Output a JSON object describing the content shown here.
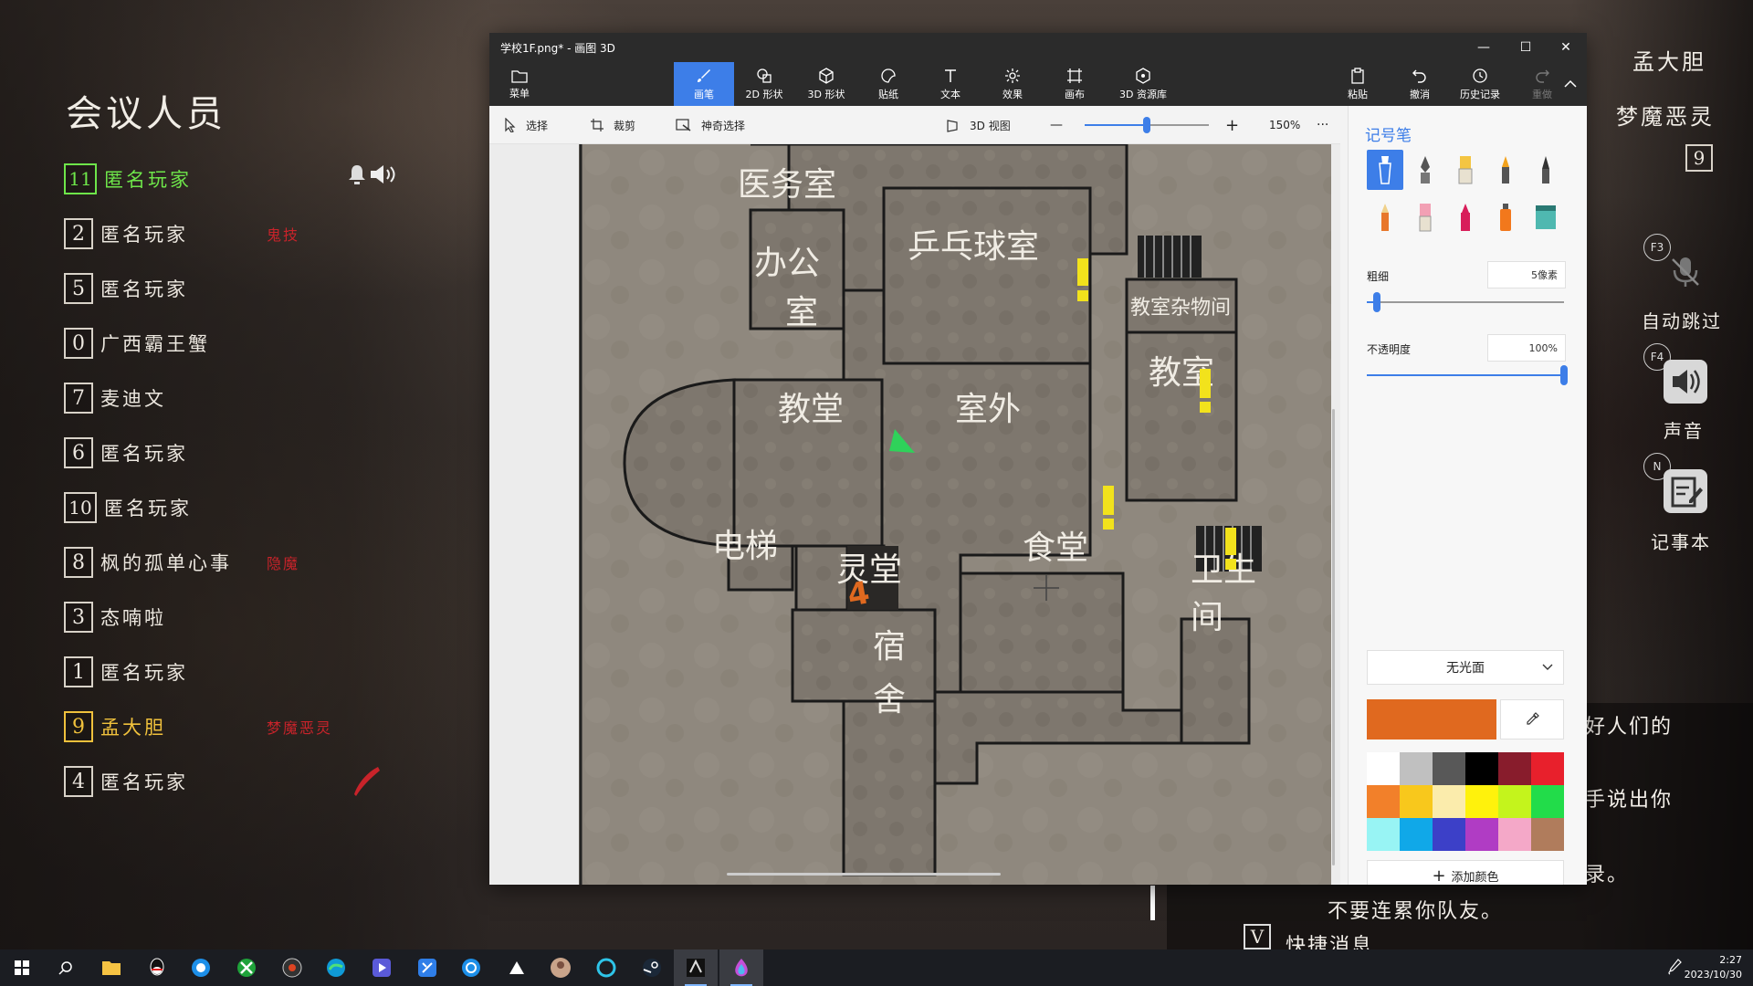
{
  "game": {
    "participants_title": "会议人员",
    "participants": [
      {
        "num": "11",
        "name": "匿名玩家",
        "tag": "",
        "state": "speaking"
      },
      {
        "num": "2",
        "name": "匿名玩家",
        "tag": "鬼技",
        "state": "normal"
      },
      {
        "num": "5",
        "name": "匿名玩家",
        "tag": "",
        "state": "normal"
      },
      {
        "num": "0",
        "name": "广西霸王蟹",
        "tag": "",
        "state": "normal"
      },
      {
        "num": "7",
        "name": "麦迪文",
        "tag": "",
        "state": "normal"
      },
      {
        "num": "6",
        "name": "匿名玩家",
        "tag": "",
        "state": "normal"
      },
      {
        "num": "10",
        "name": "匿名玩家",
        "tag": "",
        "state": "normal"
      },
      {
        "num": "8",
        "name": "枫的孤单心事",
        "tag": "隐魔",
        "state": "normal"
      },
      {
        "num": "3",
        "name": "态喃啦",
        "tag": "",
        "state": "normal"
      },
      {
        "num": "1",
        "name": "匿名玩家",
        "tag": "",
        "state": "normal"
      },
      {
        "num": "9",
        "name": "孟大胆",
        "tag": "梦魔恶灵",
        "state": "gold"
      },
      {
        "num": "4",
        "name": "匿名玩家",
        "tag": "",
        "state": "normal"
      }
    ],
    "hud": {
      "player_name": "孟大胆",
      "player_role": "梦魔恶灵",
      "player_number": "9",
      "auto_skip_key": "F3",
      "auto_skip_label": "自动跳过",
      "sound_key": "F4",
      "sound_label": "声音",
      "notebook_key": "N",
      "notebook_label": "记事本"
    },
    "chat": {
      "line1": "好人们的",
      "line2": "手说出你",
      "line3": "录。",
      "line4": "不要连累你队友。",
      "quick_key": "V",
      "quick_label": "快捷消息"
    }
  },
  "paint": {
    "window_title": "学校1F.png* - 画图 3D",
    "controls": {
      "minimize": "—",
      "maximize": "☐",
      "close": "✕"
    },
    "ribbon": [
      {
        "label": "菜单",
        "icon": "folder-icon",
        "state": "normal"
      },
      {
        "label": "画笔",
        "icon": "brush-icon",
        "state": "active"
      },
      {
        "label": "2D 形状",
        "icon": "shapes-2d-icon",
        "state": "normal"
      },
      {
        "label": "3D 形状",
        "icon": "shapes-3d-icon",
        "state": "normal"
      },
      {
        "label": "贴纸",
        "icon": "sticker-icon",
        "state": "normal"
      },
      {
        "label": "文本",
        "icon": "text-icon",
        "state": "normal"
      },
      {
        "label": "效果",
        "icon": "effects-icon",
        "state": "normal"
      },
      {
        "label": "画布",
        "icon": "canvas-icon",
        "state": "normal"
      },
      {
        "label": "3D 资源库",
        "icon": "library-3d-icon",
        "state": "normal"
      },
      {
        "label": "粘贴",
        "icon": "paste-icon",
        "state": "normal"
      },
      {
        "label": "撤消",
        "icon": "undo-icon",
        "state": "normal"
      },
      {
        "label": "历史记录",
        "icon": "history-icon",
        "state": "normal"
      },
      {
        "label": "重做",
        "icon": "redo-icon",
        "state": "disabled"
      }
    ],
    "cmd": {
      "select": "选择",
      "crop": "裁剪",
      "magic_select": "神奇选择",
      "view_3d": "3D 视图",
      "zoom_minus": "—",
      "zoom_plus": "+",
      "zoom_level": "150%",
      "zoom_fraction": 0.5,
      "more": "···"
    },
    "panel": {
      "title": "记号笔",
      "thickness_label": "粗细",
      "thickness_value": "5像素",
      "thickness_fraction": 0.05,
      "opacity_label": "不透明度",
      "opacity_value": "100%",
      "opacity_fraction": 1.0,
      "finish": "无光面",
      "current_color": "#e0691f",
      "add_color": "添加颜色",
      "palette": [
        "#ffffff",
        "#c0c0c0",
        "#585858",
        "#000000",
        "#881c2c",
        "#e8202c",
        "#f2802a",
        "#f8c81c",
        "#fbecac",
        "#fff20c",
        "#c4f41c",
        "#22dc4a",
        "#98f4f4",
        "#10a8e8",
        "#3c40c8",
        "#b03cc4",
        "#f4a8c8",
        "#b07c5c"
      ]
    },
    "map": {
      "rooms": {
        "infirmary": "医务室",
        "office": "办公",
        "office2": "室",
        "pingpong": "乒乓球室",
        "storage": "教室杂物间",
        "chapel": "教堂",
        "outdoor": "室外",
        "classroom": "教室",
        "elevator": "电梯",
        "spirit_hall": "灵堂",
        "canteen": "食堂",
        "toilet": "卫生",
        "toilet2": "间",
        "dorm": "宿",
        "dorm2": "舍"
      },
      "annotation_number": "4"
    }
  },
  "taskbar": {
    "icons": [
      "windows-icon",
      "search-icon",
      "file-explorer-icon",
      "qq-icon",
      "browser-icon",
      "xbox-icon",
      "steam-helper-icon",
      "edge-icon",
      "media-icon",
      "tool-icon",
      "qq-browser-icon",
      "game-icon",
      "avatar-icon",
      "app-icon",
      "steam-icon",
      "game-logo-icon",
      "paint-3d-icon"
    ],
    "time": "2:27",
    "date": "2023/10/30"
  }
}
